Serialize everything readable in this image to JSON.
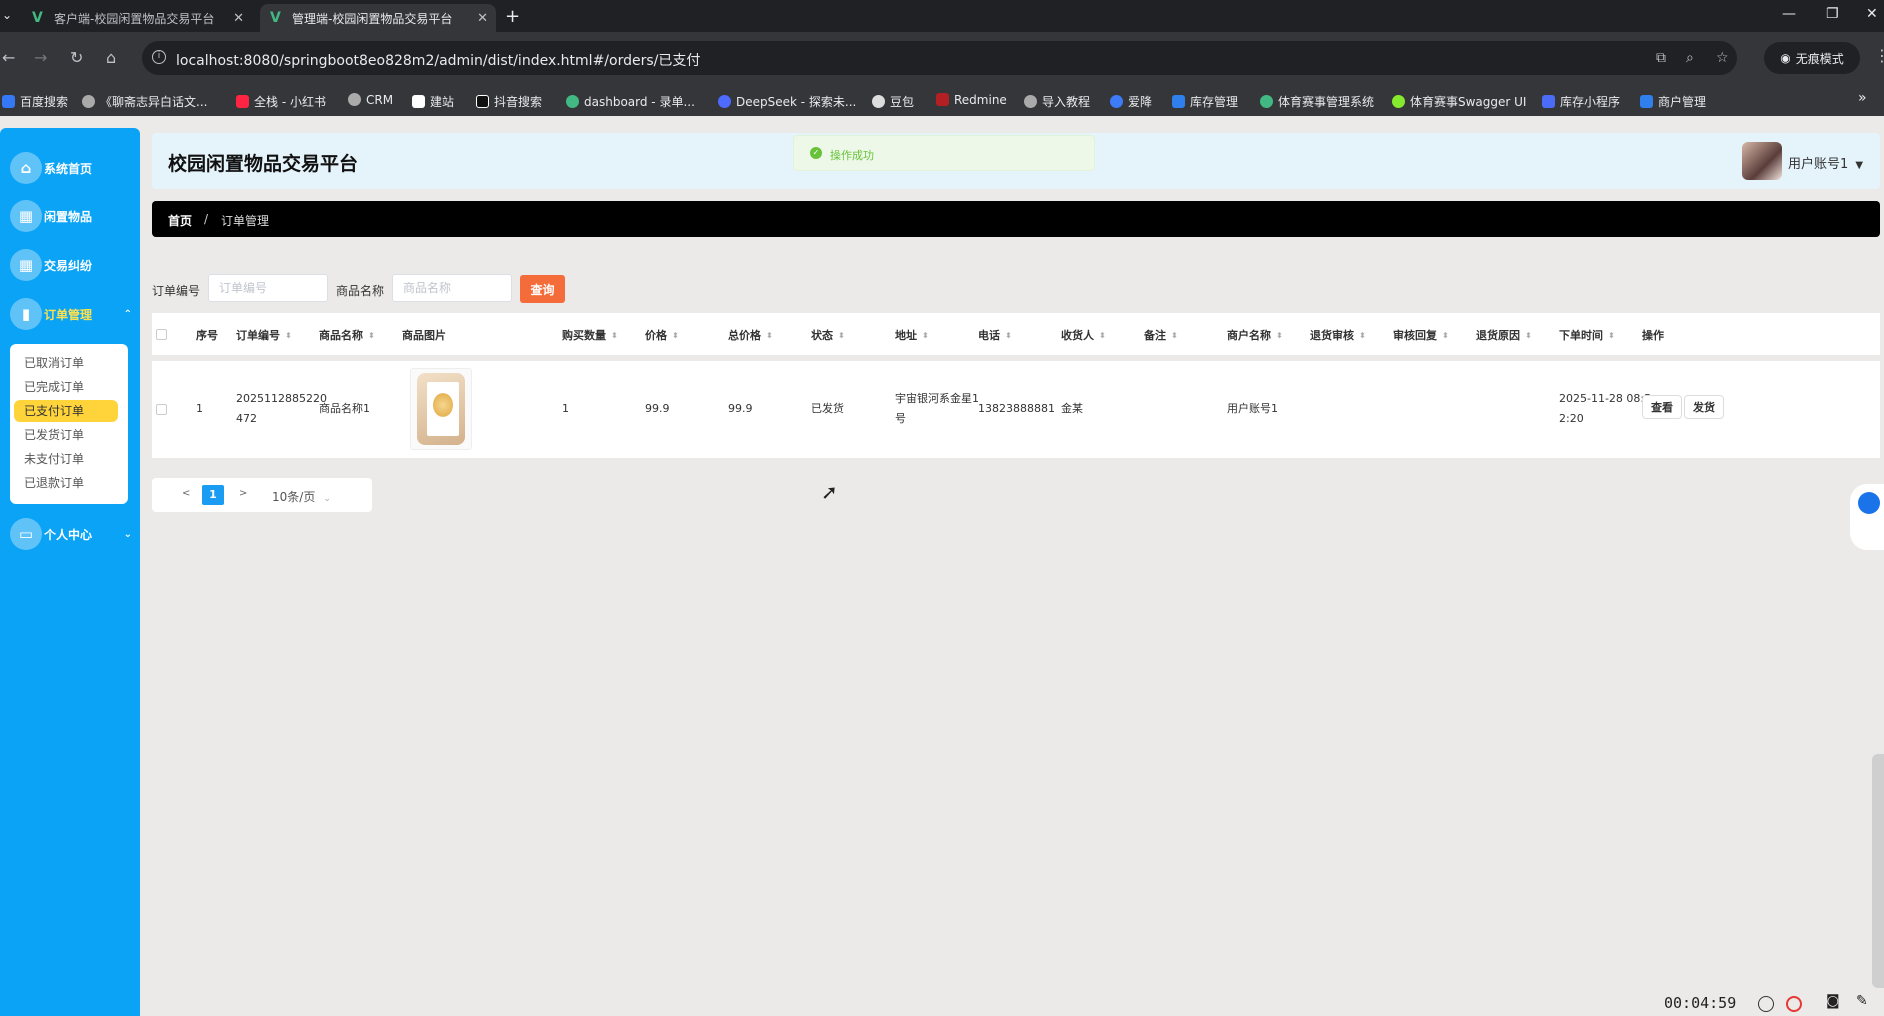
{
  "browser": {
    "tabs": [
      {
        "title": "客户端-校园闲置物品交易平台",
        "active": false
      },
      {
        "title": "管理端-校园闲置物品交易平台",
        "active": true
      }
    ],
    "url": "localhost:8080/springboot8eo828m2/admin/dist/index.html#/orders/已支付",
    "incognito_label": "无痕模式",
    "bookmarks": [
      "百度搜索",
      "《聊斋志异白话文...",
      "全栈 - 小红书",
      "CRM",
      "建站",
      "抖音搜索",
      "dashboard - 录单...",
      "DeepSeek - 探索未...",
      "豆包",
      "Redmine",
      "导入教程",
      "爱降",
      "库存管理",
      "体育赛事管理系统",
      "体育赛事Swagger UI",
      "库存小程序",
      "商户管理"
    ]
  },
  "app": {
    "title": "校园闲置物品交易平台",
    "user": "用户账号1",
    "toast": "操作成功"
  },
  "sidebar": {
    "items": [
      {
        "label": "系统首页",
        "icon": "home-icon"
      },
      {
        "label": "闲置物品",
        "icon": "grid-icon"
      },
      {
        "label": "交易纠纷",
        "icon": "grid-icon"
      },
      {
        "label": "订单管理",
        "icon": "chart-icon",
        "active": true
      },
      {
        "label": "个人中心",
        "icon": "card-icon"
      }
    ],
    "submenu": [
      "已取消订单",
      "已完成订单",
      "已支付订单",
      "已发货订单",
      "未支付订单",
      "已退款订单"
    ],
    "active_sub": "已支付订单"
  },
  "breadcrumb": {
    "home": "首页",
    "sep": "/",
    "current": "订单管理"
  },
  "search": {
    "order_label": "订单编号",
    "order_placeholder": "订单编号",
    "product_label": "商品名称",
    "product_placeholder": "商品名称",
    "button": "查询"
  },
  "table": {
    "headers": [
      "序号",
      "订单编号",
      "商品名称",
      "商品图片",
      "购买数量",
      "价格",
      "总价格",
      "状态",
      "地址",
      "电话",
      "收货人",
      "备注",
      "商户名称",
      "退货审核",
      "审核回复",
      "退货原因",
      "下单时间",
      "操作"
    ],
    "rows": [
      {
        "index": "1",
        "order_no_1": "2025112885220",
        "order_no_2": "472",
        "product": "商品名称1",
        "quantity": "1",
        "price": "99.9",
        "total": "99.9",
        "status": "已发货",
        "address_1": "宇宙银河系金星1",
        "address_2": "号",
        "phone": "13823888881",
        "receiver": "金某",
        "remark": "",
        "merchant": "用户账号1",
        "time_1": "2025-11-28 08:5",
        "time_2": "2:20",
        "actions": [
          "查看",
          "发货"
        ]
      }
    ]
  },
  "pagination": {
    "prev": "<",
    "page": "1",
    "next": ">",
    "page_size": "10条/页"
  },
  "recorder": {
    "time": "00:04:59"
  }
}
